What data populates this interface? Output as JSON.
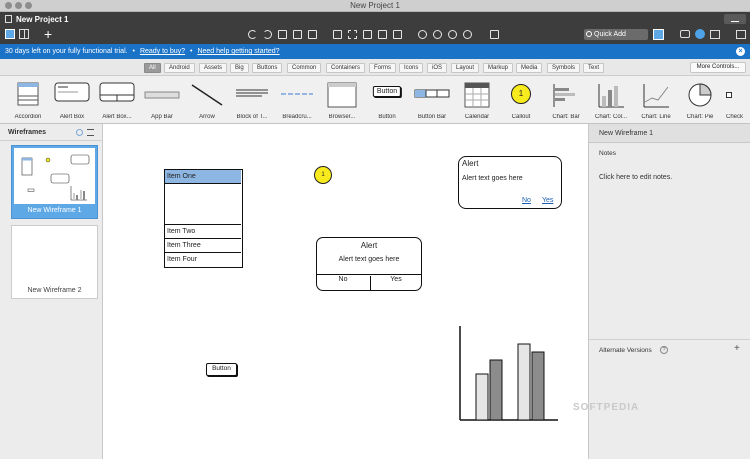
{
  "window": {
    "title": "New Project 1"
  },
  "toolbar": {
    "project_name": "New Project 1",
    "quick_add_label": "Quick Add"
  },
  "trial": {
    "message": "30 days left on your fully functional trial.",
    "sep1": "•",
    "buy_link": "Ready to buy?",
    "sep2": "•",
    "help_link": "Need help getting started?",
    "close": "×"
  },
  "categories": [
    "All",
    "Android",
    "Assets",
    "Big",
    "Buttons",
    "Common",
    "Containers",
    "Forms",
    "Icons",
    "iOS",
    "Layout",
    "Markup",
    "Media",
    "Symbols",
    "Text"
  ],
  "more_controls_label": "More Controls...",
  "library": [
    "Accordion",
    "Alert Box",
    "Alert Box...",
    "App Bar",
    "Arrow",
    "Block of T...",
    "Breadcru...",
    "Browser...",
    "Button",
    "Button Bar",
    "Calendar",
    "Callout",
    "Chart: Bar",
    "Chart: Col...",
    "Chart: Line",
    "Chart: Pie",
    "Check"
  ],
  "library_button_text": "Button",
  "library_callout_text": "1",
  "left_panel": {
    "title": "Wireframes",
    "wireframes": [
      {
        "label": "New Wireframe 1"
      },
      {
        "label": "New Wireframe 2"
      }
    ]
  },
  "canvas": {
    "list": {
      "items": [
        "Item One",
        "Item Two",
        "Item Three",
        "Item Four"
      ]
    },
    "callout_number": "1",
    "alert_top": {
      "title": "Alert",
      "text": "Alert text goes here",
      "no": "No",
      "yes": "Yes"
    },
    "alert_mid": {
      "title": "Alert",
      "text": "Alert text goes here",
      "no": "No",
      "yes": "Yes"
    },
    "button_label": "Button"
  },
  "right_panel": {
    "title": "New Wireframe 1",
    "notes_label": "Notes",
    "notes_placeholder": "Click here to edit notes.",
    "alt_versions_label": "Alternate Versions",
    "alt_help": "?",
    "alt_add": "+"
  },
  "watermark": "SOFTPEDIA"
}
